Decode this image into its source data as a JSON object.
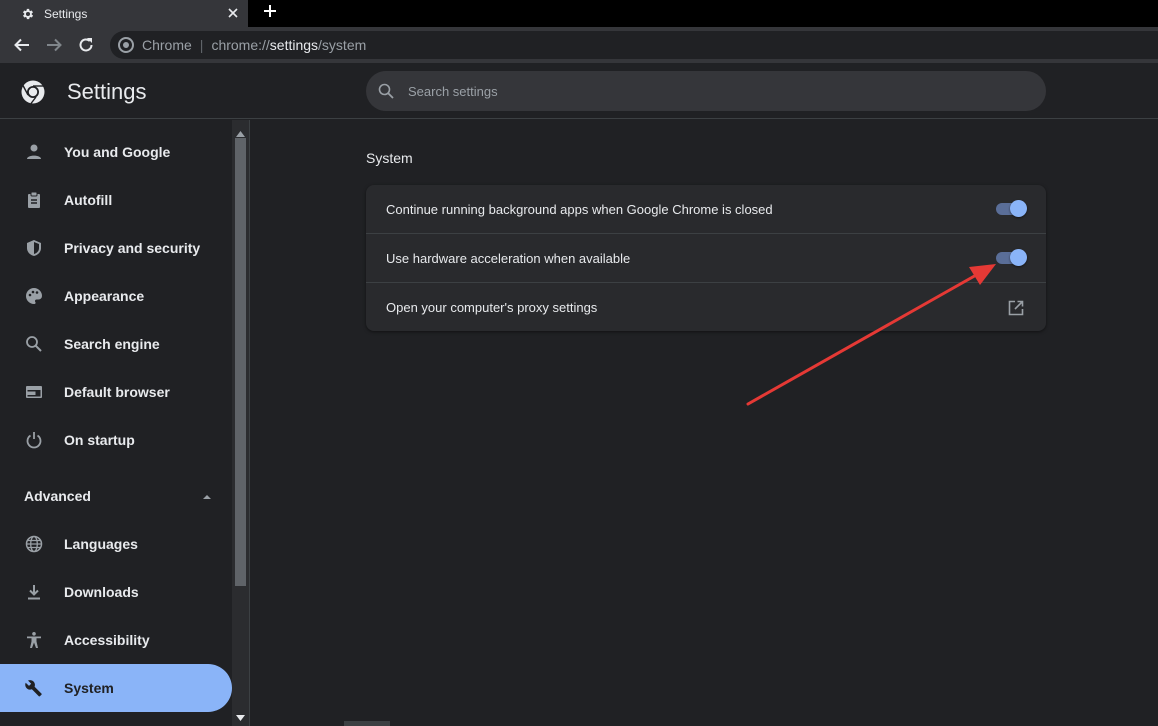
{
  "tab": {
    "title": "Settings"
  },
  "omnibox": {
    "label": "Chrome",
    "separator": "|",
    "scheme": "chrome://",
    "host": "settings",
    "path": "/system"
  },
  "header": {
    "title": "Settings",
    "search_placeholder": "Search settings"
  },
  "sidebar": {
    "items": [
      {
        "label": "You and Google",
        "icon": "person-icon"
      },
      {
        "label": "Autofill",
        "icon": "clipboard-icon"
      },
      {
        "label": "Privacy and security",
        "icon": "shield-icon"
      },
      {
        "label": "Appearance",
        "icon": "palette-icon"
      },
      {
        "label": "Search engine",
        "icon": "search-icon"
      },
      {
        "label": "Default browser",
        "icon": "browser-icon"
      },
      {
        "label": "On startup",
        "icon": "power-icon"
      }
    ],
    "advanced_label": "Advanced",
    "advanced_items": [
      {
        "label": "Languages",
        "icon": "globe-icon"
      },
      {
        "label": "Downloads",
        "icon": "download-icon"
      },
      {
        "label": "Accessibility",
        "icon": "accessibility-icon"
      },
      {
        "label": "System",
        "icon": "wrench-icon",
        "selected": true
      }
    ]
  },
  "main": {
    "section_title": "System",
    "rows": [
      {
        "label": "Continue running background apps when Google Chrome is closed",
        "control": "toggle",
        "on": true
      },
      {
        "label": "Use hardware acceleration when available",
        "control": "toggle",
        "on": true
      },
      {
        "label": "Open your computer's proxy settings",
        "control": "external-link-icon"
      }
    ]
  },
  "colors": {
    "accent": "#8ab4f8",
    "annotation_arrow": "#e53935"
  }
}
